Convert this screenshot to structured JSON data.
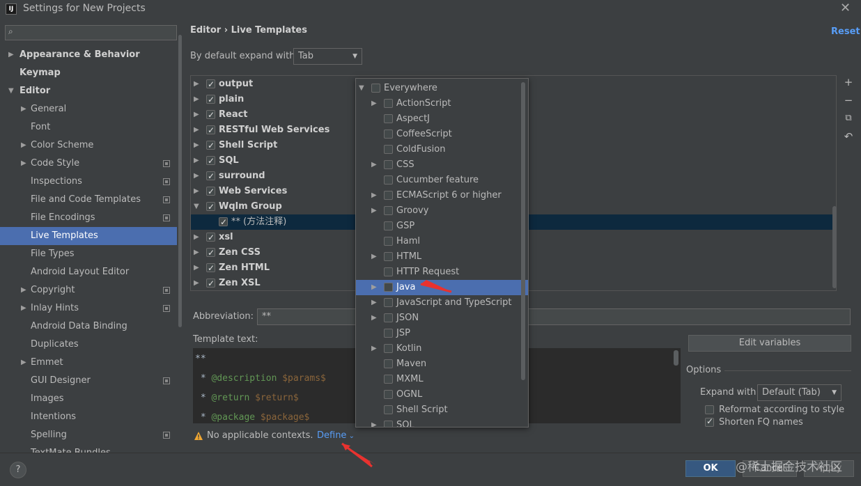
{
  "window": {
    "app_icon": "IJ",
    "title": "Settings for New Projects",
    "close_icon": "close-icon"
  },
  "sidebar": {
    "search_placeholder": "",
    "items": [
      {
        "label": "Appearance & Behavior",
        "level": 0,
        "arrow": "right",
        "bold": true
      },
      {
        "label": "Keymap",
        "level": 0,
        "arrow": "",
        "bold": true
      },
      {
        "label": "Editor",
        "level": 0,
        "arrow": "down",
        "bold": true
      },
      {
        "label": "General",
        "level": 1,
        "arrow": "right"
      },
      {
        "label": "Font",
        "level": 1,
        "arrow": ""
      },
      {
        "label": "Color Scheme",
        "level": 1,
        "arrow": "right"
      },
      {
        "label": "Code Style",
        "level": 1,
        "arrow": "right",
        "proj": true
      },
      {
        "label": "Inspections",
        "level": 1,
        "arrow": "",
        "proj": true
      },
      {
        "label": "File and Code Templates",
        "level": 1,
        "arrow": "",
        "proj": true
      },
      {
        "label": "File Encodings",
        "level": 1,
        "arrow": "",
        "proj": true
      },
      {
        "label": "Live Templates",
        "level": 1,
        "arrow": "",
        "selected": true
      },
      {
        "label": "File Types",
        "level": 1,
        "arrow": ""
      },
      {
        "label": "Android Layout Editor",
        "level": 1,
        "arrow": ""
      },
      {
        "label": "Copyright",
        "level": 1,
        "arrow": "right",
        "proj": true
      },
      {
        "label": "Inlay Hints",
        "level": 1,
        "arrow": "right",
        "proj": true
      },
      {
        "label": "Android Data Binding",
        "level": 1,
        "arrow": ""
      },
      {
        "label": "Duplicates",
        "level": 1,
        "arrow": ""
      },
      {
        "label": "Emmet",
        "level": 1,
        "arrow": "right"
      },
      {
        "label": "GUI Designer",
        "level": 1,
        "arrow": "",
        "proj": true
      },
      {
        "label": "Images",
        "level": 1,
        "arrow": ""
      },
      {
        "label": "Intentions",
        "level": 1,
        "arrow": ""
      },
      {
        "label": "Spelling",
        "level": 1,
        "arrow": "",
        "proj": true
      },
      {
        "label": "TextMate Bundles",
        "level": 1,
        "arrow": ""
      }
    ]
  },
  "header": {
    "breadcrumb": "Editor  ›  Live Templates",
    "reset": "Reset"
  },
  "expand": {
    "label": "By default expand with",
    "value": "Tab"
  },
  "templates": [
    {
      "label": "output",
      "arrow": "right",
      "checked": true
    },
    {
      "label": "plain",
      "arrow": "right",
      "checked": true
    },
    {
      "label": "React",
      "arrow": "right",
      "checked": true
    },
    {
      "label": "RESTful Web Services",
      "arrow": "right",
      "checked": true
    },
    {
      "label": "Shell Script",
      "arrow": "right",
      "checked": true
    },
    {
      "label": "SQL",
      "arrow": "right",
      "checked": true
    },
    {
      "label": "surround",
      "arrow": "right",
      "checked": true
    },
    {
      "label": "Web Services",
      "arrow": "right",
      "checked": true
    },
    {
      "label": "Wqlm Group",
      "arrow": "down",
      "checked": true
    },
    {
      "label": "** (方法注释)",
      "arrow": "",
      "checked": true,
      "child": true,
      "selected": true
    },
    {
      "label": "xsl",
      "arrow": "right",
      "checked": true
    },
    {
      "label": "Zen CSS",
      "arrow": "right",
      "checked": true
    },
    {
      "label": "Zen HTML",
      "arrow": "right",
      "checked": true
    },
    {
      "label": "Zen XSL",
      "arrow": "right",
      "checked": true
    }
  ],
  "toolbar": {
    "add": "+",
    "remove": "−",
    "copy": "⧉",
    "undo": "↶"
  },
  "abbreviation": {
    "label": "Abbreviation:",
    "value": "**"
  },
  "template_text": {
    "label": "Template text:",
    "lines": [
      {
        "a": "**",
        "b": "",
        "c": ""
      },
      {
        "a": " * ",
        "b": "@description",
        "c": " $params$"
      },
      {
        "a": " * ",
        "b": "@return",
        "c": " $return$"
      },
      {
        "a": " * ",
        "b": "@package",
        "c": " $package$"
      }
    ]
  },
  "edit_variables": "Edit variables",
  "options": {
    "title": "Options",
    "expand_label": "Expand with",
    "expand_value": "Default (Tab)",
    "reformat": "Reformat according to style",
    "shorten": "Shorten FQ names"
  },
  "warning": {
    "text": "No applicable contexts.",
    "define": "Define"
  },
  "contexts": [
    {
      "label": "Everywhere",
      "arrow": "down",
      "top": true
    },
    {
      "label": "ActionScript",
      "arrow": "right"
    },
    {
      "label": "AspectJ",
      "arrow": ""
    },
    {
      "label": "CoffeeScript",
      "arrow": ""
    },
    {
      "label": "ColdFusion",
      "arrow": ""
    },
    {
      "label": "CSS",
      "arrow": "right"
    },
    {
      "label": "Cucumber feature",
      "arrow": ""
    },
    {
      "label": "ECMAScript 6 or higher",
      "arrow": "right"
    },
    {
      "label": "Groovy",
      "arrow": "right"
    },
    {
      "label": "GSP",
      "arrow": ""
    },
    {
      "label": "Haml",
      "arrow": ""
    },
    {
      "label": "HTML",
      "arrow": "right"
    },
    {
      "label": "HTTP Request",
      "arrow": ""
    },
    {
      "label": "Java",
      "arrow": "right",
      "selected": true
    },
    {
      "label": "JavaScript and TypeScript",
      "arrow": "right"
    },
    {
      "label": "JSON",
      "arrow": "right"
    },
    {
      "label": "JSP",
      "arrow": ""
    },
    {
      "label": "Kotlin",
      "arrow": "right"
    },
    {
      "label": "Maven",
      "arrow": ""
    },
    {
      "label": "MXML",
      "arrow": ""
    },
    {
      "label": "OGNL",
      "arrow": ""
    },
    {
      "label": "Shell Script",
      "arrow": ""
    },
    {
      "label": "SQL",
      "arrow": "right"
    }
  ],
  "buttons": {
    "help": "?",
    "ok": "OK",
    "cancel": "Cancel",
    "apply": "Apply"
  },
  "watermark": "@稀土掘金技术社区",
  "colors": {
    "selection": "#4b6eaf",
    "link": "#589df6",
    "arrow_annotation": "#e8322f"
  }
}
